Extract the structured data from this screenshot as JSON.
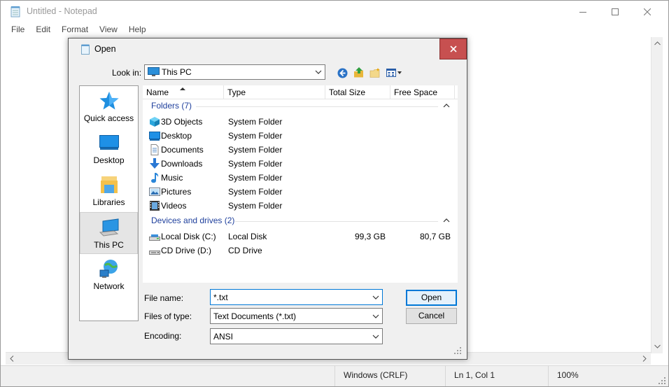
{
  "notepad": {
    "title": "Untitled - Notepad",
    "menu": [
      "File",
      "Edit",
      "Format",
      "View",
      "Help"
    ],
    "status": {
      "line_ending": "Windows (CRLF)",
      "position": "Ln 1, Col 1",
      "zoom": "100%"
    }
  },
  "dialog": {
    "title": "Open",
    "look_in_label": "Look in:",
    "look_in_value": "This PC",
    "places": [
      {
        "label": "Quick access",
        "icon": "star-icon"
      },
      {
        "label": "Desktop",
        "icon": "desktop-icon"
      },
      {
        "label": "Libraries",
        "icon": "libraries-icon"
      },
      {
        "label": "This PC",
        "icon": "this-pc-icon",
        "selected": true
      },
      {
        "label": "Network",
        "icon": "network-icon"
      }
    ],
    "columns": [
      "Name",
      "Type",
      "Total Size",
      "Free Space"
    ],
    "folders_group": "Folders (7)",
    "folders": [
      {
        "name": "3D Objects",
        "type": "System Folder",
        "icon": "3d-objects-icon"
      },
      {
        "name": "Desktop",
        "type": "System Folder",
        "icon": "desktop-icon"
      },
      {
        "name": "Documents",
        "type": "System Folder",
        "icon": "documents-icon"
      },
      {
        "name": "Downloads",
        "type": "System Folder",
        "icon": "downloads-icon"
      },
      {
        "name": "Music",
        "type": "System Folder",
        "icon": "music-icon"
      },
      {
        "name": "Pictures",
        "type": "System Folder",
        "icon": "pictures-icon"
      },
      {
        "name": "Videos",
        "type": "System Folder",
        "icon": "videos-icon"
      }
    ],
    "drives_group": "Devices and drives (2)",
    "drives": [
      {
        "name": "Local Disk (C:)",
        "type": "Local Disk",
        "total": "99,3 GB",
        "free": "80,7 GB",
        "icon": "hard-drive-icon"
      },
      {
        "name": "CD Drive (D:)",
        "type": "CD Drive",
        "total": "",
        "free": "",
        "icon": "cd-drive-icon"
      }
    ],
    "file_name_label": "File name:",
    "file_name_value": "*.txt",
    "file_type_label": "Files of type:",
    "file_type_value": "Text Documents (*.txt)",
    "encoding_label": "Encoding:",
    "encoding_value": "ANSI",
    "open_label": "Open",
    "cancel_label": "Cancel"
  },
  "colors": {
    "accent": "#0078d7",
    "close_red": "#c75050",
    "group_header": "#1e3f9c"
  }
}
